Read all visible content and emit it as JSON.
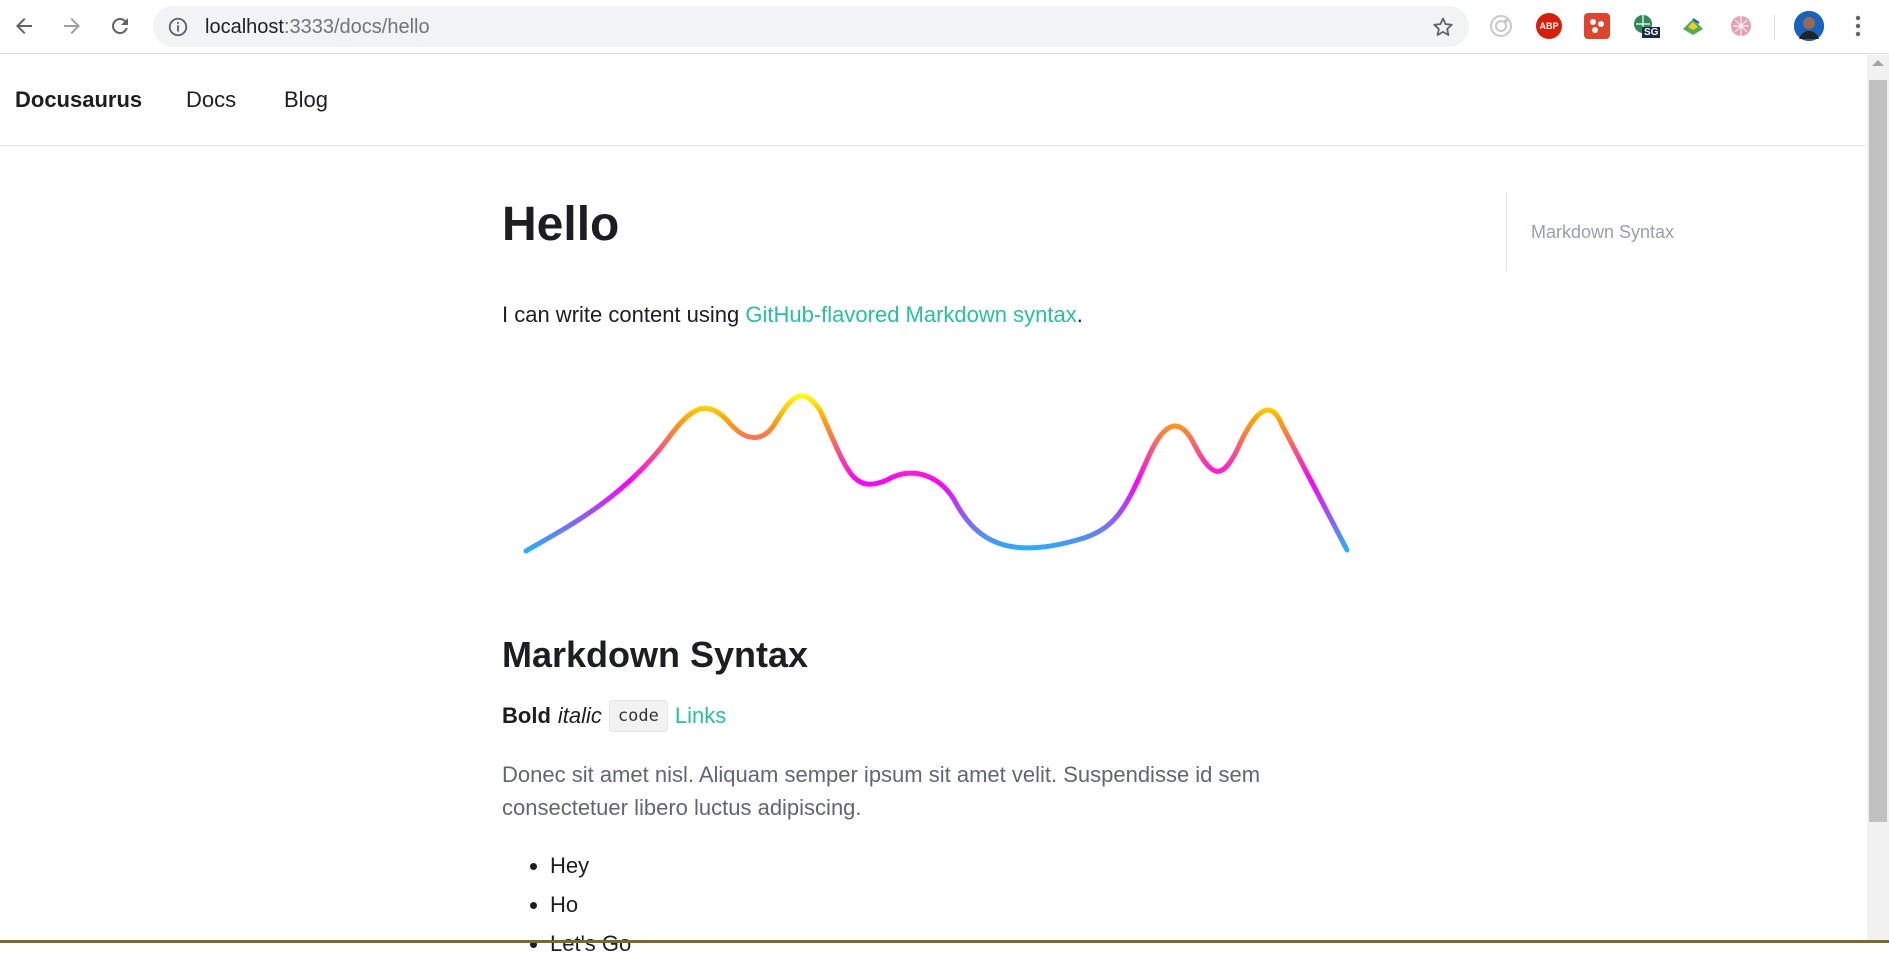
{
  "browser": {
    "url_host": "localhost",
    "url_rest": ":3333/docs/hello",
    "extensions": [
      "ext-icon-1",
      "abp-icon",
      "ext-icon-3",
      "sg-icon",
      "ext-icon-5",
      "ext-icon-6"
    ],
    "abp_label": "ABP",
    "sg_label": "SG"
  },
  "navbar": {
    "brand": "Docusaurus",
    "links": [
      "Docs",
      "Blog"
    ]
  },
  "page": {
    "title": "Hello",
    "intro_text": "I can write content using ",
    "intro_link": "GitHub-flavored Markdown syntax",
    "intro_end": ".",
    "section_title": "Markdown Syntax",
    "bold": "Bold",
    "italic": "italic",
    "code": "code",
    "link": "Links",
    "paragraph": "Donec sit amet nisl. Aliquam semper ipsum sit amet velit. Suspendisse id sem consectetuer libero luctus adipiscing.",
    "list": [
      "Hey",
      "Ho",
      "Let's Go"
    ]
  },
  "toc": {
    "items": [
      "Markdown Syntax"
    ]
  },
  "colors": {
    "accent": "#25c2a0",
    "wave_low": "#1fb6ff",
    "wave_mid": "#ff00ff",
    "wave_high": "#ffff00"
  }
}
